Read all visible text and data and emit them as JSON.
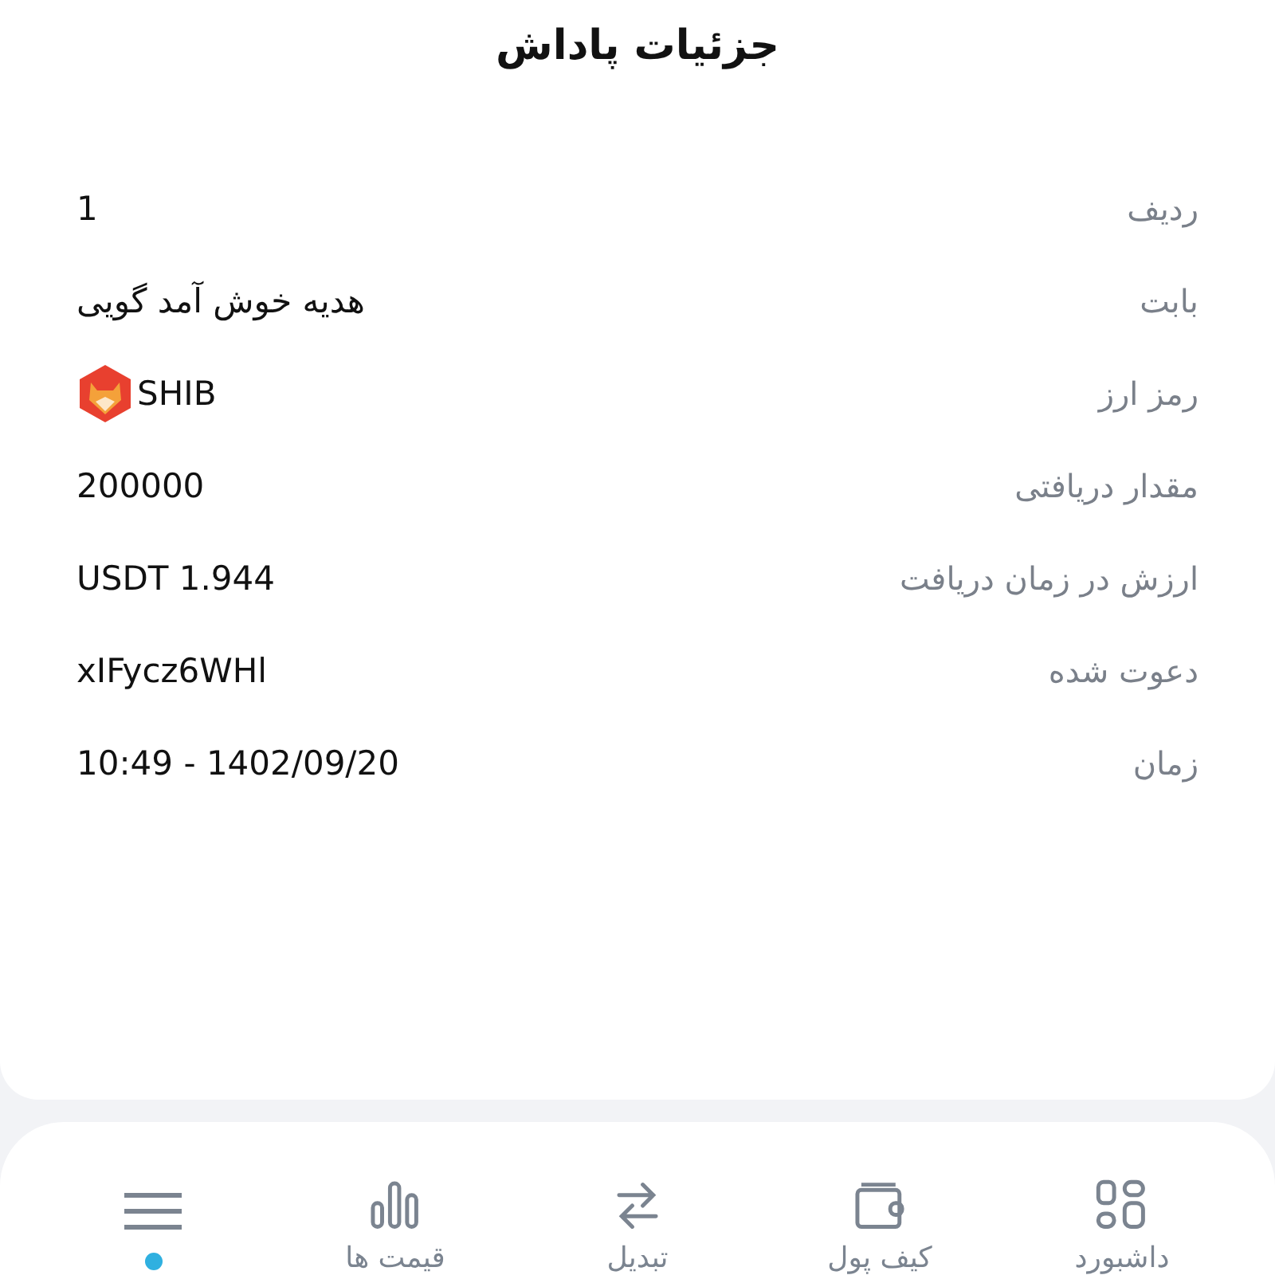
{
  "header": {
    "title": "جزئیات پاداش"
  },
  "details": [
    {
      "label": "ردیف",
      "value": "1",
      "kind": "text"
    },
    {
      "label": "بابت",
      "value": "هدیه خوش آمد گویی",
      "kind": "text"
    },
    {
      "label": "رمز ارز",
      "value": "SHIB",
      "kind": "coin"
    },
    {
      "label": "مقدار دریافتی",
      "value": "200000",
      "kind": "text"
    },
    {
      "label": "ارزش در زمان دریافت",
      "value": "USDT 1.944",
      "kind": "text"
    },
    {
      "label": "دعوت شده",
      "value": "xIFycz6WHl",
      "kind": "text"
    },
    {
      "label": "زمان",
      "value": "10:49 - 1402/09/20",
      "kind": "text"
    }
  ],
  "bottom_nav": [
    {
      "label": "داشبورد",
      "kind": "dashboard",
      "dot": false
    },
    {
      "label": "کیف پول",
      "kind": "wallet",
      "dot": false
    },
    {
      "label": "تبدیل",
      "kind": "swap",
      "dot": false
    },
    {
      "label": "قیمت ها",
      "kind": "chart",
      "dot": false
    },
    {
      "kind": "menu",
      "dot": true
    }
  ]
}
